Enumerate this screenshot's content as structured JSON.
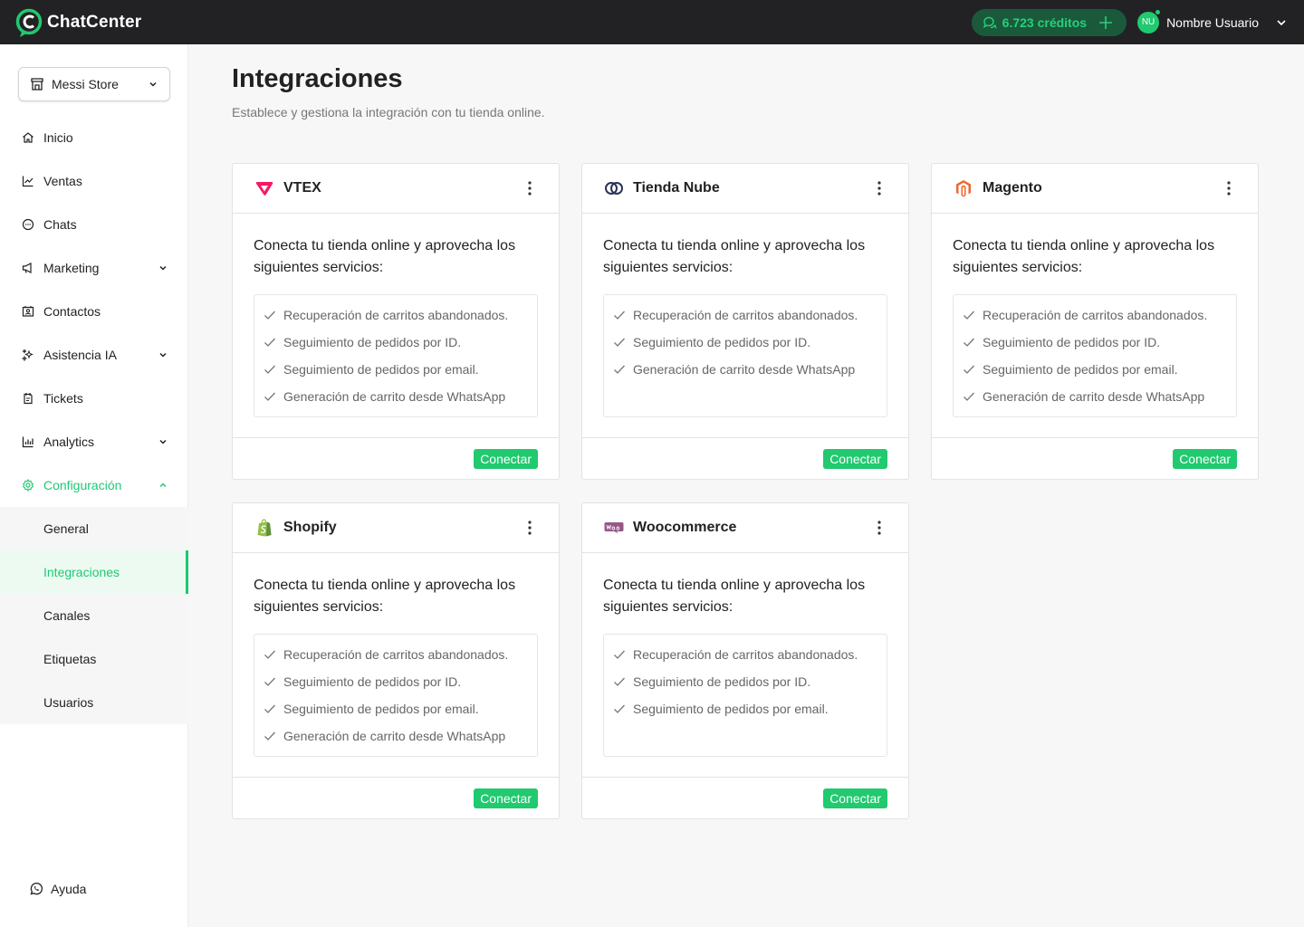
{
  "app": {
    "name": "ChatCenter"
  },
  "topbar": {
    "credits_label": "6.723 créditos",
    "user_initials": "NU",
    "user_name": "Nombre Usuario"
  },
  "sidebar": {
    "store": "Messi Store",
    "items": [
      {
        "label": "Inicio",
        "icon": "home-icon"
      },
      {
        "label": "Ventas",
        "icon": "chart-line-icon"
      },
      {
        "label": "Chats",
        "icon": "chat-icon"
      },
      {
        "label": "Marketing",
        "icon": "megaphone-icon",
        "expandable": true
      },
      {
        "label": "Contactos",
        "icon": "contacts-icon"
      },
      {
        "label": "Asistencia IA",
        "icon": "sparkles-icon",
        "expandable": true
      },
      {
        "label": "Tickets",
        "icon": "ticket-icon"
      },
      {
        "label": "Analytics",
        "icon": "bar-chart-icon",
        "expandable": true
      },
      {
        "label": "Configuración",
        "icon": "gear-icon",
        "expanded": true
      }
    ],
    "submenu": [
      "General",
      "Integraciones",
      "Canales",
      "Etiquetas",
      "Usuarios"
    ],
    "active_submenu": "Integraciones",
    "help_label": "Ayuda"
  },
  "page": {
    "title": "Integraciones",
    "subtitle": "Establece y gestiona la integración con tu tienda online."
  },
  "cards": [
    {
      "name": "VTEX",
      "logo": "vtex-logo",
      "color": "#f71963",
      "description": "Conecta tu tienda online y aprovecha los siguientes servicios:",
      "services": [
        "Recuperación de carritos abandonados.",
        "Seguimiento de pedidos por ID.",
        "Seguimiento de pedidos por email.",
        "Generación de carrito desde WhatsApp"
      ],
      "button": "Conectar"
    },
    {
      "name": "Tienda Nube",
      "logo": "tiendanube-logo",
      "color": "#2c3357",
      "description": "Conecta tu tienda online y aprovecha los siguientes servicios:",
      "services": [
        "Recuperación de carritos abandonados.",
        "Seguimiento de pedidos por ID.",
        "Generación de carrito desde WhatsApp"
      ],
      "button": "Conectar"
    },
    {
      "name": "Magento",
      "logo": "magento-logo",
      "color": "#ee672f",
      "description": "Conecta tu tienda online y aprovecha los siguientes servicios:",
      "services": [
        "Recuperación de carritos abandonados.",
        "Seguimiento de pedidos por ID.",
        "Seguimiento de pedidos por email.",
        "Generación de carrito desde WhatsApp"
      ],
      "button": "Conectar"
    },
    {
      "name": "Shopify",
      "logo": "shopify-logo",
      "color": "#95bf47",
      "description": "Conecta tu tienda online y aprovecha los siguientes servicios:",
      "services": [
        "Recuperación de carritos abandonados.",
        "Seguimiento de pedidos por ID.",
        "Seguimiento de pedidos por email.",
        "Generación de carrito desde WhatsApp"
      ],
      "button": "Conectar"
    },
    {
      "name": "Woocommerce",
      "logo": "woocommerce-logo",
      "color": "#96588a",
      "description": "Conecta tu tienda online y aprovecha los siguientes servicios:",
      "services": [
        "Recuperación de carritos abandonados.",
        "Seguimiento de pedidos por ID.",
        "Seguimiento de pedidos por email."
      ],
      "button": "Conectar"
    }
  ],
  "colors": {
    "accent": "#21c96f",
    "topbar": "#222224"
  }
}
